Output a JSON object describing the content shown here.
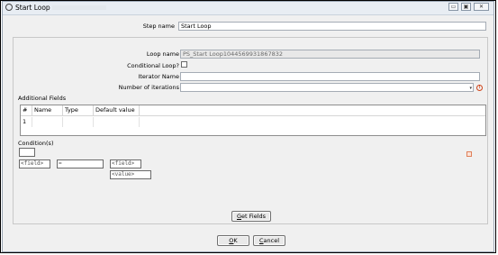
{
  "window": {
    "title": "Start Loop",
    "controls": {
      "minimize": "▭",
      "maximize": "▣",
      "close": "✕"
    }
  },
  "form": {
    "step_name_label": "Step name",
    "step_name_value": "Start Loop",
    "loop_name_label": "Loop name",
    "loop_name_value": "PS_Start Loop1044569931867832",
    "conditional_loop_label": "Conditional Loop?",
    "conditional_loop_checked": false,
    "iterator_name_label": "Iterator Name",
    "iterator_name_value": "",
    "iterations_label": "Number of iterations",
    "iterations_value": "",
    "warning_icon": "!",
    "dropdown_icon": "▾"
  },
  "additional_fields": {
    "label": "Additional Fields",
    "columns": [
      "#",
      "Name",
      "Type",
      "Default value"
    ],
    "rows": [
      {
        "num": "1",
        "name": "",
        "type": "",
        "default": ""
      }
    ]
  },
  "conditions": {
    "label": "Condition(s)",
    "left_field": "<field>",
    "operator": "=",
    "right_field": "<field>",
    "right_value": "<value>"
  },
  "buttons": {
    "get_fields_prefix": "G",
    "get_fields_rest": "et Fields",
    "ok_prefix": "O",
    "ok_rest": "K",
    "cancel_prefix": "C",
    "cancel_rest": "ancel"
  },
  "colors": {
    "title_bar": "#e8edf3",
    "dialog_bg": "#f0f0f0",
    "warning": "#d0451b"
  }
}
